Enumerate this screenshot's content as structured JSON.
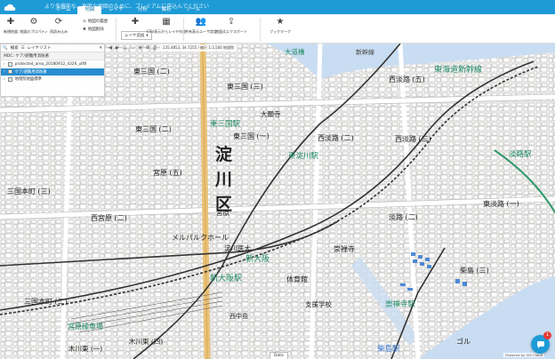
{
  "topbar": {
    "message": "より多機能な、高度な地図のために、プレミアムに申込んでください",
    "tabs": [
      {
        "label": "ホーム",
        "active": false
      },
      {
        "label": "地図",
        "active": true
      },
      {
        "label": "レイヤ",
        "active": false
      },
      {
        "label": "分析",
        "active": false
      },
      {
        "label": "解析",
        "active": false
      },
      {
        "label": "ツール",
        "active": false
      }
    ]
  },
  "ribbon": {
    "new_map": "新規地図",
    "map_properties": "地図のプロパティ",
    "reload": "再読み込み",
    "map_list": "地図の履歴",
    "delete_map": "地図削除",
    "add_layer": "レイヤ追加",
    "add_layer_select": "レイヤ追加",
    "csv_layer": "CSV表示からレイヤ作成",
    "share": "共有表示ユーザ設定",
    "export": "地図式エクスポート",
    "bookmark": "ブックマーク"
  },
  "panel": {
    "toolbar_labels": [
      "検索",
      "レイヤリスト"
    ],
    "title": "MDC: ケア/避難用消防著",
    "rows": [
      {
        "label": "protected_area_20180912_4326_utf8",
        "selected": false
      },
      {
        "label": "ケア/避難用消防著",
        "selected": true
      },
      {
        "label": "地理院地図標準",
        "selected": false
      }
    ]
  },
  "map": {
    "coord_text": "135.4853, 34.7255 / 縮尺 1:3,500 地理院",
    "labels": {
      "ward_1": "淀",
      "ward_2": "川",
      "ward_3": "区",
      "east_mikuni_1": "東三国 (二)",
      "east_mikuni_2": "東三国 (三)",
      "east_mikuni_3": "東三国 (二)",
      "east_mikuni_4": "東三国 (一)",
      "east_mikuni_station": "東三国駅",
      "miyahara_5": "宮原 (五)",
      "miyahara": "宮原",
      "nishi_miyahara": "西宮原 (二)",
      "mikunihon_3": "三国本町 (三)",
      "mikunihon_2": "三国本町 (二)",
      "daidoji": "大願寺",
      "higashinakajima": "東中島",
      "higashiyodogawa_station": "東淀川駅",
      "nishiawaji_1": "西淡路 (二)",
      "nishiawaji_5": "西淡路 (五)",
      "nishiawaji_3": "西淡路 (三)",
      "awaji": "淡路 (二)",
      "awaji_station": "淡路駅",
      "higashiawaji": "東淡路 (一)",
      "sozenji": "崇禅寺",
      "sozenji_station": "崇禅寺駅",
      "shin_osaka_station": "新大阪駅",
      "shin_osaka": "新大阪",
      "meruparuku": "メルパルクホール",
      "tairyoukan": "体育館",
      "shiengakko": "支援学校",
      "kunijima": "柴島 (三)",
      "kunijima_station": "柴島駅",
      "kitajimaakio": "宮原操車場",
      "kizawa": "木川東 (四)",
      "kigawa": "木川東 (一)",
      "nishinakajima": "西中島",
      "tokaido": "東海道新幹線",
      "shinkansen": "新幹線",
      "okubashi": "大道橋",
      "yodogawa_hospital": "淀川医大",
      "goruf": "ゴル"
    }
  },
  "footer": {
    "credit": "Powered by GIS Cloud",
    "data_tab": "Data",
    "chat_badge": "1"
  },
  "colors": {
    "brand": "#1e9bd7",
    "river": "#c9ddf2",
    "rail_green": "#1f8a64"
  }
}
